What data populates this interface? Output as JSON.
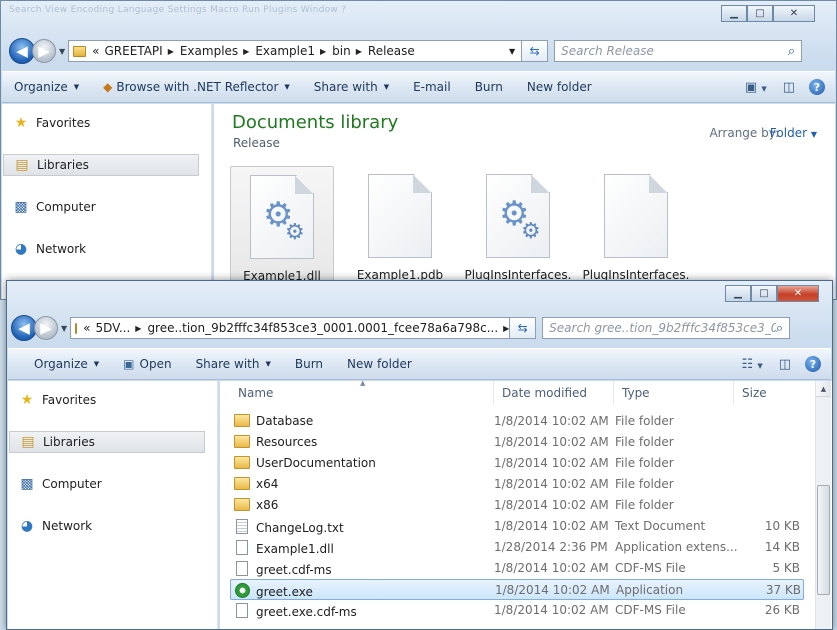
{
  "window1": {
    "menu_ghost": "Search   View   Encoding   Language   Settings   Macro   Run   Plugins   Window   ?",
    "address": {
      "overflow": "«",
      "crumbs": [
        "GREETAPI",
        "Examples",
        "Example1",
        "bin",
        "Release"
      ]
    },
    "search_placeholder": "Search Release",
    "toolbar": {
      "organize": "Organize",
      "browse": "Browse with .NET Reflector",
      "share": "Share with",
      "email": "E-mail",
      "burn": "Burn",
      "new_folder": "New folder"
    },
    "nav": {
      "favorites": "Favorites",
      "libraries": "Libraries",
      "computer": "Computer",
      "network": "Network"
    },
    "library": {
      "title": "Documents library",
      "subtitle": "Release",
      "arrange_label": "Arrange by:",
      "arrange_value": "Folder"
    },
    "files": [
      {
        "name": "Example1.dll",
        "icon": "gear-file-icon"
      },
      {
        "name": "Example1.pdb",
        "icon": "blank-file-icon"
      },
      {
        "name": "PlugInsInterfaces.",
        "icon": "gear-file-icon"
      },
      {
        "name": "PlugInsInterfaces.",
        "icon": "blank-file-icon"
      }
    ]
  },
  "window2": {
    "address": {
      "overflow": "«",
      "crumbs": [
        "5DV...",
        "gree..tion_9b2fffc34f853ce3_0001.0001_fcee78a6a798c..."
      ]
    },
    "search_placeholder": "Search gree..tion_9b2fffc34f853ce3_0001...",
    "toolbar": {
      "organize": "Organize",
      "open": "Open",
      "share": "Share with",
      "burn": "Burn",
      "new_folder": "New folder"
    },
    "nav": {
      "favorites": "Favorites",
      "libraries": "Libraries",
      "computer": "Computer",
      "network": "Network"
    },
    "columns": {
      "name": "Name",
      "date": "Date modified",
      "type": "Type",
      "size": "Size"
    },
    "rows": [
      {
        "name": "Database",
        "date": "1/8/2014 10:02 AM",
        "type": "File folder",
        "size": "",
        "icon": "folder"
      },
      {
        "name": "Resources",
        "date": "1/8/2014 10:02 AM",
        "type": "File folder",
        "size": "",
        "icon": "folder"
      },
      {
        "name": "UserDocumentation",
        "date": "1/8/2014 10:02 AM",
        "type": "File folder",
        "size": "",
        "icon": "folder"
      },
      {
        "name": "x64",
        "date": "1/8/2014 10:02 AM",
        "type": "File folder",
        "size": "",
        "icon": "folder"
      },
      {
        "name": "x86",
        "date": "1/8/2014 10:02 AM",
        "type": "File folder",
        "size": "",
        "icon": "folder"
      },
      {
        "name": "ChangeLog.txt",
        "date": "1/8/2014 10:02 AM",
        "type": "Text Document",
        "size": "10 KB",
        "icon": "text"
      },
      {
        "name": "Example1.dll",
        "date": "1/28/2014 2:36 PM",
        "type": "Application extens...",
        "size": "14 KB",
        "icon": "dll"
      },
      {
        "name": "greet.cdf-ms",
        "date": "1/8/2014 10:02 AM",
        "type": "CDF-MS File",
        "size": "5 KB",
        "icon": "cdf"
      },
      {
        "name": "greet.exe",
        "date": "1/8/2014 10:02 AM",
        "type": "Application",
        "size": "37 KB",
        "icon": "exe",
        "selected": true
      },
      {
        "name": "greet.exe.cdf-ms",
        "date": "1/8/2014 10:02 AM",
        "type": "CDF-MS File",
        "size": "26 KB",
        "icon": "cdf"
      }
    ]
  }
}
